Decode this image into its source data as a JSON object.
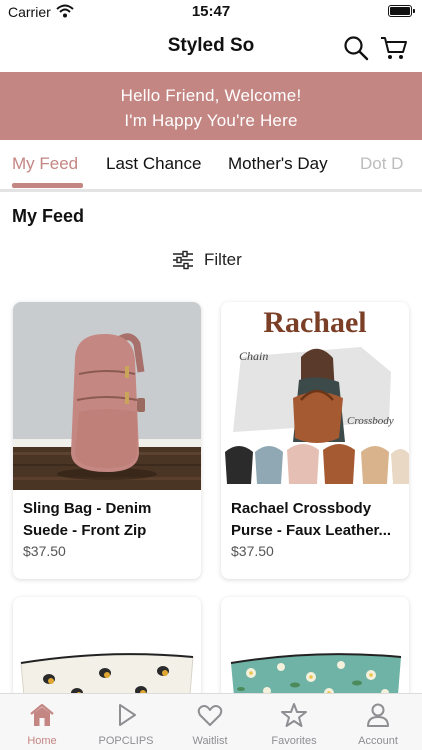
{
  "status_bar": {
    "carrier": "Carrier",
    "time": "15:47"
  },
  "header": {
    "title": "Styled So",
    "icons": [
      "search-icon",
      "cart-icon"
    ]
  },
  "banner": {
    "line1": "Hello Friend, Welcome!",
    "line2": "I'm Happy You're Here"
  },
  "tabs": [
    {
      "label": "My Feed",
      "active": true
    },
    {
      "label": "Last Chance",
      "active": false
    },
    {
      "label": "Mother's Day",
      "active": false
    },
    {
      "label": "Dot D",
      "active": false
    }
  ],
  "feed": {
    "title": "My Feed",
    "filter_label": "Filter",
    "products": [
      {
        "name": "Sling Bag - Denim Suede - Front Zip",
        "price": "$37.50"
      },
      {
        "name": "Rachael Crossbody Purse - Faux Leather...",
        "price": "$37.50",
        "image_text": {
          "title": "Rachael",
          "left": "Chain",
          "right": "Crossbody"
        }
      },
      {
        "name": "",
        "price": ""
      },
      {
        "name": "",
        "price": ""
      }
    ]
  },
  "tabbar": [
    {
      "label": "Home",
      "icon": "home-icon",
      "active": true
    },
    {
      "label": "POPCLIPS",
      "icon": "play-icon",
      "active": false
    },
    {
      "label": "Waitlist",
      "icon": "heart-icon",
      "active": false
    },
    {
      "label": "Favorites",
      "icon": "star-icon",
      "active": false
    },
    {
      "label": "Account",
      "icon": "person-icon",
      "active": false
    }
  ],
  "colors": {
    "accent": "#c48683",
    "banner": "#c48683",
    "inactive": "#8e8e93"
  }
}
